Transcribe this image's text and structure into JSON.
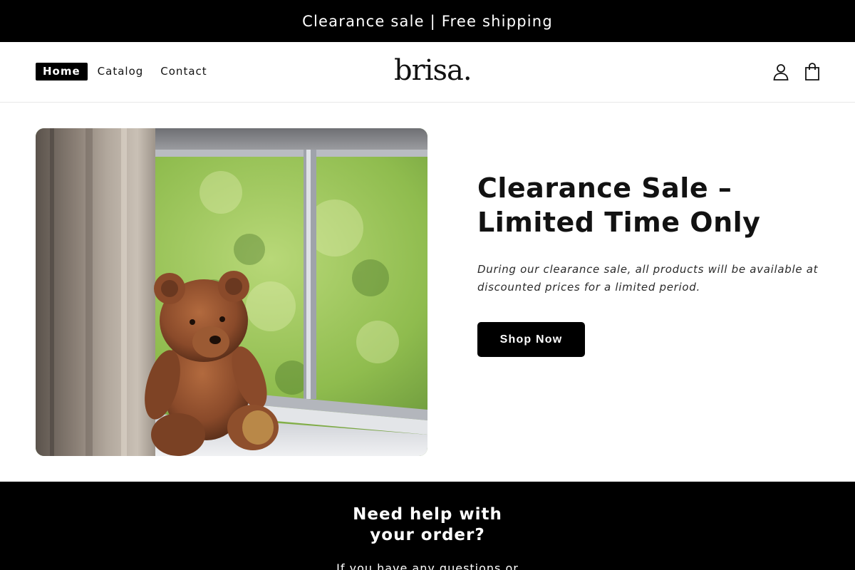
{
  "announcement": {
    "text": "Clearance sale | Free shipping"
  },
  "header": {
    "logo": "brisa.",
    "nav": [
      {
        "label": "Home",
        "active": true
      },
      {
        "label": "Catalog",
        "active": false
      },
      {
        "label": "Contact",
        "active": false
      }
    ],
    "icons": [
      "account-icon",
      "cart-icon"
    ]
  },
  "hero": {
    "image_subject": "teddy-bear-by-window",
    "title_line1": "Clearance Sale –",
    "title_line2": "Limited Time Only",
    "description_line1": "During our clearance sale, all products will be available at",
    "description_line2": "discounted prices for a limited period.",
    "button_label": "Shop Now"
  },
  "help": {
    "title_line1": "Need help with",
    "title_line2": "your order?",
    "text": "If you have any questions or"
  },
  "colors": {
    "primary": "#000000",
    "background": "#ffffff",
    "text": "#121212"
  }
}
